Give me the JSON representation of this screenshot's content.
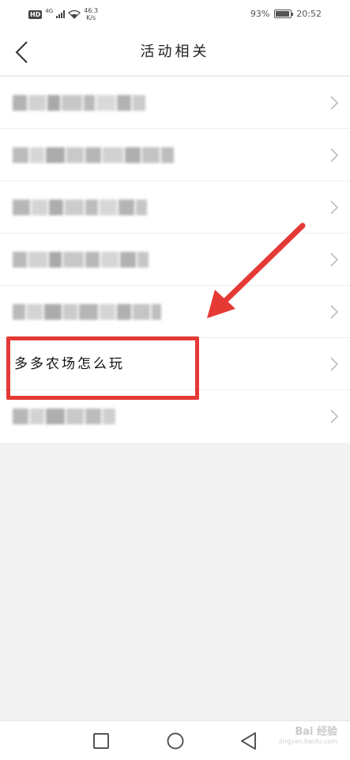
{
  "status_bar": {
    "hd": "HD",
    "network_type": "4G",
    "speed_value": "46.3",
    "speed_unit": "K/s",
    "battery_percent": "93%",
    "battery_level": 0.93,
    "time": "20:52"
  },
  "header": {
    "title": "活动相关",
    "back_icon": "chevron-left-icon"
  },
  "list": {
    "items": [
      {
        "label": "",
        "blurred": true
      },
      {
        "label": "",
        "blurred": true
      },
      {
        "label": "",
        "blurred": true
      },
      {
        "label": "",
        "blurred": true
      },
      {
        "label": "",
        "blurred": true
      },
      {
        "label": "多多农场怎么玩",
        "blurred": false,
        "highlighted": true
      },
      {
        "label": "",
        "blurred": true
      }
    ],
    "chevron_icon": "chevron-right-icon"
  },
  "annotation": {
    "color": "#e53935",
    "arrow_icon": "red-arrow-icon"
  },
  "nav_bar": {
    "recents_icon": "square-icon",
    "home_icon": "circle-icon",
    "back_icon": "triangle-back-icon"
  },
  "watermark": {
    "brand": "Bai 经验",
    "url": "jingyan.baidu.com"
  }
}
